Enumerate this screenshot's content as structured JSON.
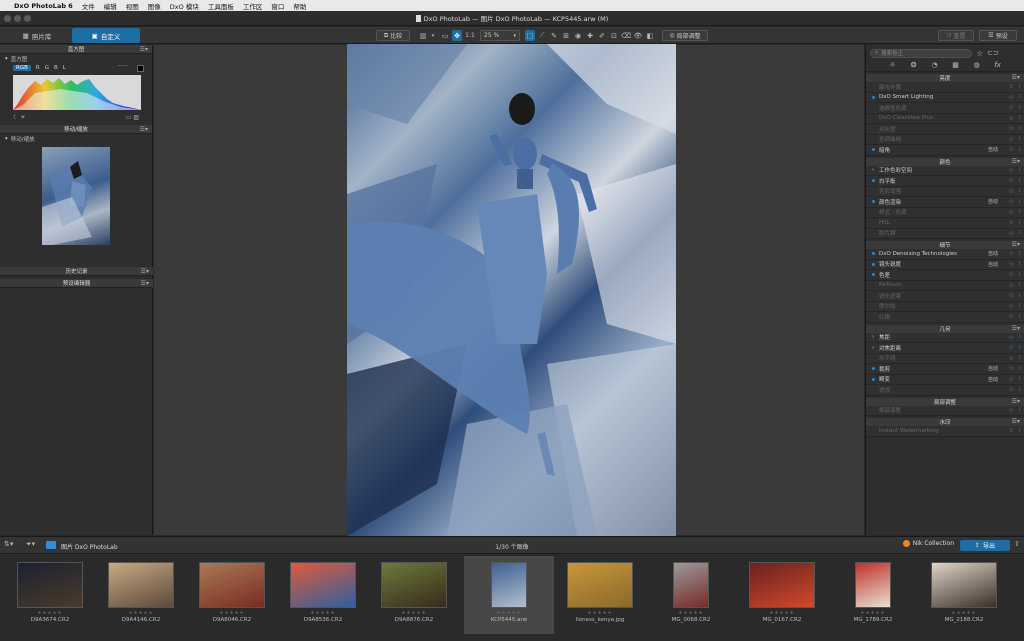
{
  "menubar": {
    "apple_icon": "apple-icon",
    "app": "DxO PhotoLab 6",
    "items": [
      "文件",
      "编辑",
      "视图",
      "图像",
      "DxO 模块",
      "工具面板",
      "工作区",
      "窗口",
      "帮助"
    ]
  },
  "window": {
    "title": "DxO PhotoLab — 图片 DxO PhotoLab — KCP5445.arw (M)"
  },
  "toolbar": {
    "tab_library": "照片库",
    "tab_customize": "自定义",
    "compare": "比较",
    "zoom_ratio": "1:1",
    "zoom_level": "25 %",
    "local_adjust": "局部调整",
    "reset": "重置",
    "preset": "预设"
  },
  "left_panel": {
    "histogram_title": "直方图",
    "histogram_sub": "直方图",
    "channels": [
      "RGB",
      "R",
      "G",
      "B",
      "L"
    ],
    "navigator_title": "移动/缩放",
    "navigator_sub": "移动/缩放",
    "history_title": "历史记录",
    "preset_editor_title": "预设编辑器"
  },
  "right_panel": {
    "search_placeholder": "搜索校正",
    "sections": [
      {
        "title": "亮度",
        "rows": [
          {
            "label": "曝光补偿",
            "on": false,
            "auto": ""
          },
          {
            "label": "DxO Smart Lighting",
            "on": true,
            "auto": ""
          },
          {
            "label": "选择性色调",
            "on": false,
            "auto": ""
          },
          {
            "label": "DxO ClearView Plus",
            "on": false,
            "auto": ""
          },
          {
            "label": "对比度",
            "on": false,
            "auto": ""
          },
          {
            "label": "色调曲线",
            "on": false,
            "auto": ""
          },
          {
            "label": "暗角",
            "on": true,
            "auto": "自动"
          }
        ]
      },
      {
        "title": "颜色",
        "rows": [
          {
            "label": "工作色彩空间",
            "on": true,
            "auto": "",
            "chevron": true
          },
          {
            "label": "白平衡",
            "on": true,
            "auto": ""
          },
          {
            "label": "色彩增强",
            "on": false,
            "auto": ""
          },
          {
            "label": "颜色渲染",
            "on": true,
            "auto": "自动"
          },
          {
            "label": "样式 - 色调",
            "on": false,
            "auto": ""
          },
          {
            "label": "HSL",
            "on": false,
            "auto": ""
          },
          {
            "label": "胶片颗",
            "on": false,
            "auto": ""
          }
        ]
      },
      {
        "title": "细节",
        "rows": [
          {
            "label": "DxO Denoising Technologies",
            "on": true,
            "auto": "自动"
          },
          {
            "label": "镜头锐度",
            "on": true,
            "auto": "自动"
          },
          {
            "label": "色差",
            "on": true,
            "auto": ""
          },
          {
            "label": "ReTouch",
            "on": false,
            "auto": ""
          },
          {
            "label": "锐化遮罩",
            "on": false,
            "auto": ""
          },
          {
            "label": "摩尔纹",
            "on": false,
            "auto": ""
          },
          {
            "label": "红眼",
            "on": false,
            "auto": ""
          }
        ]
      },
      {
        "title": "几何",
        "rows": [
          {
            "label": "焦距",
            "on": true,
            "auto": "",
            "chevron": true
          },
          {
            "label": "对焦距离",
            "on": true,
            "auto": "",
            "chevron": true
          },
          {
            "label": "水平线",
            "on": false,
            "auto": ""
          },
          {
            "label": "裁剪",
            "on": true,
            "auto": "自动"
          },
          {
            "label": "畸变",
            "on": true,
            "auto": "自动"
          },
          {
            "label": "透视",
            "on": false,
            "auto": ""
          }
        ]
      },
      {
        "title": "局部调整",
        "rows": [
          {
            "label": "局部调整",
            "on": false,
            "auto": ""
          }
        ]
      },
      {
        "title": "水印",
        "rows": [
          {
            "label": "Instant Watermarking",
            "on": false,
            "auto": ""
          }
        ]
      }
    ]
  },
  "filmstrip": {
    "folder": "图片 DxO PhotoLab",
    "count": "1/30 个图像",
    "nik": "Nik Collection",
    "export": "导出",
    "thumbs": [
      {
        "name": "D9A3674.CR2",
        "c1": "#1c2230",
        "c2": "#4a3a2c"
      },
      {
        "name": "D9A4146.CR2",
        "c1": "#c9a985",
        "c2": "#5b4a3a"
      },
      {
        "name": "D9A8046.CR2",
        "c1": "#a97a55",
        "c2": "#7a2b22"
      },
      {
        "name": "D9A8536.CR2",
        "c1": "#e05a3a",
        "c2": "#2f5fa0"
      },
      {
        "name": "D9A8876.CR2",
        "c1": "#6b7a3a",
        "c2": "#3a2a1c"
      },
      {
        "name": "KCP5445.arw",
        "c1": "#3d5f8f",
        "c2": "#b3c0cf"
      },
      {
        "name": "lioness_kenya.jpg",
        "c1": "#c9963a",
        "c2": "#8a6a2a"
      },
      {
        "name": "MG_0068.CR2",
        "c1": "#9a9a9a",
        "c2": "#7a2a2a"
      },
      {
        "name": "MG_0167.CR2",
        "c1": "#6a2020",
        "c2": "#d04a2a"
      },
      {
        "name": "MG_1789.CR2",
        "c1": "#c0302a",
        "c2": "#e8e0d0"
      },
      {
        "name": "MG_2188.CR2",
        "c1": "#e0d4c8",
        "c2": "#3a3028"
      }
    ]
  },
  "stars": "★★★★★"
}
